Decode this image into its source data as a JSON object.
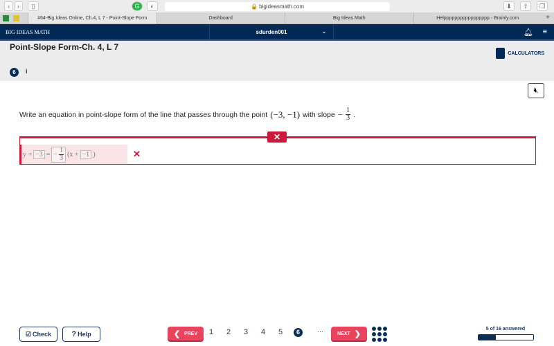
{
  "browser": {
    "url": "bigideasmath.com",
    "tabs": [
      {
        "label": "#64-Big Ideas Online, Ch.4, L 7 - Point-Slope Form",
        "active": true
      },
      {
        "label": "Dashboard"
      },
      {
        "label": "Big Ideas Math"
      },
      {
        "label": "Helppppppppppppppppp - Brainly.com"
      }
    ]
  },
  "nav": {
    "brand": "BIG IDEAS MATH",
    "user": "sdurden001"
  },
  "header": {
    "title": "Point-Slope Form-Ch. 4, L 7",
    "calculators": "CALCULATORS"
  },
  "question": {
    "number": "6",
    "info": "i",
    "text": "Write an equation in point-slope form of the line that passes through the point",
    "point": "(−3, −1)",
    "with_slope": "with slope",
    "slope_sign": "−",
    "slope_num": "1",
    "slope_den": "3",
    "end": "."
  },
  "answer": {
    "status": "incorrect",
    "y": "y +",
    "b1": "−3",
    "eq": "=",
    "sign": "−",
    "num": "1",
    "den": "3",
    "x": "(x +",
    "b2": "−1",
    "close": ")",
    "mark": "✕"
  },
  "footer": {
    "check": "Check",
    "help": "Help",
    "prev": "PREV",
    "next": "NEXT",
    "pages": [
      "1",
      "2",
      "3",
      "4",
      "5"
    ],
    "current": "6",
    "ellipsis": "···",
    "answered_label": "5 of 16 answered",
    "answered": 5,
    "total": 16
  },
  "colors": {
    "navy": "#002a55",
    "error": "#cc1a3a",
    "nav_button": "#e8445e"
  }
}
